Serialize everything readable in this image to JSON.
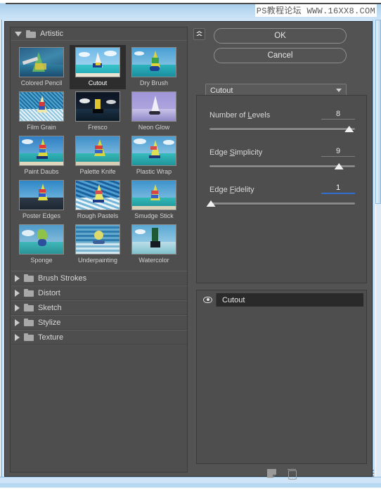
{
  "window": {
    "watermark": "PS教程论坛 WWW.16XX8.COM"
  },
  "filter_browser": {
    "expanded_category": {
      "name": "Artistic",
      "icon": "folder-icon",
      "toggle_icon": "triangle-down-icon",
      "filters": [
        {
          "label": "Colored Pencil",
          "selected": false
        },
        {
          "label": "Cutout",
          "selected": true
        },
        {
          "label": "Dry Brush",
          "selected": false
        },
        {
          "label": "Film Grain",
          "selected": false
        },
        {
          "label": "Fresco",
          "selected": false
        },
        {
          "label": "Neon Glow",
          "selected": false
        },
        {
          "label": "Paint Daubs",
          "selected": false
        },
        {
          "label": "Palette Knife",
          "selected": false
        },
        {
          "label": "Plastic Wrap",
          "selected": false
        },
        {
          "label": "Poster Edges",
          "selected": false
        },
        {
          "label": "Rough Pastels",
          "selected": false
        },
        {
          "label": "Smudge Stick",
          "selected": false
        },
        {
          "label": "Sponge",
          "selected": false
        },
        {
          "label": "Underpainting",
          "selected": false
        },
        {
          "label": "Watercolor",
          "selected": false
        }
      ]
    },
    "collapsed_categories": [
      {
        "label": "Brush Strokes",
        "icon": "folder-icon",
        "toggle_icon": "triangle-right-icon"
      },
      {
        "label": "Distort",
        "icon": "folder-icon",
        "toggle_icon": "triangle-right-icon"
      },
      {
        "label": "Sketch",
        "icon": "folder-icon",
        "toggle_icon": "triangle-right-icon"
      },
      {
        "label": "Stylize",
        "icon": "folder-icon",
        "toggle_icon": "triangle-right-icon"
      },
      {
        "label": "Texture",
        "icon": "folder-icon",
        "toggle_icon": "triangle-right-icon"
      }
    ]
  },
  "right_pane": {
    "collapse_button_icon": "double-chevron-up-icon",
    "ok_label": "OK",
    "cancel_label": "Cancel",
    "filter_select": {
      "value": "Cutout",
      "chevron_icon": "chevron-down-icon"
    },
    "parameters": [
      {
        "label": "Number of Levels",
        "mnemonic": "L",
        "value": "8",
        "fill_pct": 96,
        "active": false
      },
      {
        "label": "Edge Simplicity",
        "mnemonic": "S",
        "value": "9",
        "fill_pct": 90,
        "active": false
      },
      {
        "label": "Edge Fidelity",
        "mnemonic": "F",
        "value": "1",
        "fill_pct": 1,
        "active": true
      }
    ],
    "layers": [
      {
        "name": "Cutout",
        "visible": true,
        "eye_icon": "eye-icon"
      }
    ],
    "layer_toolbar": {
      "new_layer_icon": "new-effect-layer-icon",
      "delete_icon": "trash-icon"
    }
  },
  "colors": {
    "dialog_bg": "#535353",
    "panel_bg": "#4e4e4e",
    "selection": "#2d2d2d",
    "accent": "#2f6fd0",
    "chrome_blue": "#cfe5f7"
  }
}
